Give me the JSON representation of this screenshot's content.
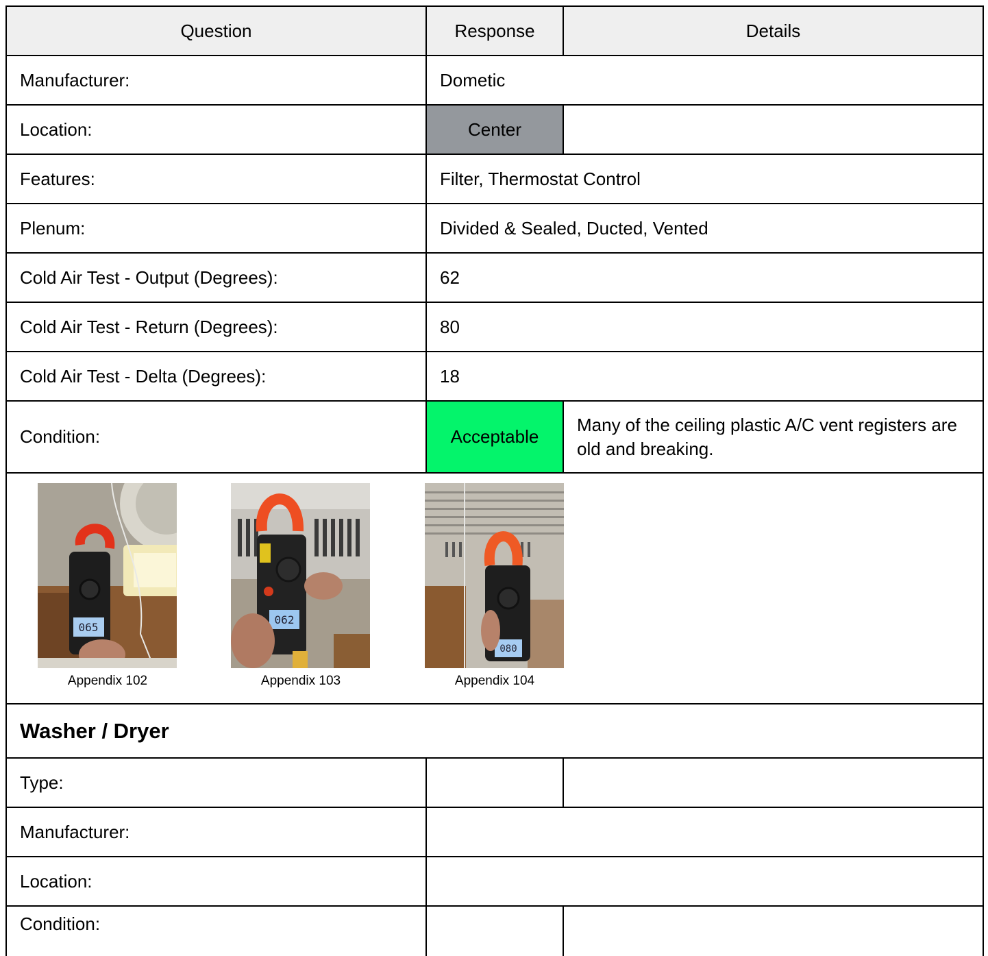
{
  "columns": {
    "question": "Question",
    "response": "Response",
    "details": "Details"
  },
  "ac_section": {
    "manufacturer": {
      "label": "Manufacturer:",
      "value": "Dometic"
    },
    "location": {
      "label": "Location:",
      "value": "Center",
      "details": ""
    },
    "features": {
      "label": "Features:",
      "value": "Filter, Thermostat Control"
    },
    "plenum": {
      "label": "Plenum:",
      "value": "Divided & Sealed, Ducted, Vented"
    },
    "output": {
      "label": "Cold Air Test - Output (Degrees):",
      "value": "62"
    },
    "return": {
      "label": "Cold Air Test - Return (Degrees):",
      "value": "80"
    },
    "delta": {
      "label": "Cold Air Test - Delta (Degrees):",
      "value": "18"
    },
    "condition": {
      "label": "Condition:",
      "value": "Acceptable",
      "details": "Many of the ceiling plastic A/C vent registers are old and breaking."
    },
    "photos": [
      {
        "caption": "Appendix 102",
        "display": "065"
      },
      {
        "caption": "Appendix 103",
        "display": "062"
      },
      {
        "caption": "Appendix 104",
        "display": "080"
      }
    ]
  },
  "washer_section": {
    "title": "Washer / Dryer",
    "type": {
      "label": "Type:",
      "value": "",
      "details": ""
    },
    "manufacturer": {
      "label": "Manufacturer:",
      "value": ""
    },
    "location": {
      "label": "Location:",
      "value": ""
    },
    "condition": {
      "label": "Condition:",
      "value": "",
      "details": ""
    }
  },
  "colors": {
    "header_bg": "#efefef",
    "location_badge": "#94989d",
    "acceptable": "#04f46b"
  }
}
